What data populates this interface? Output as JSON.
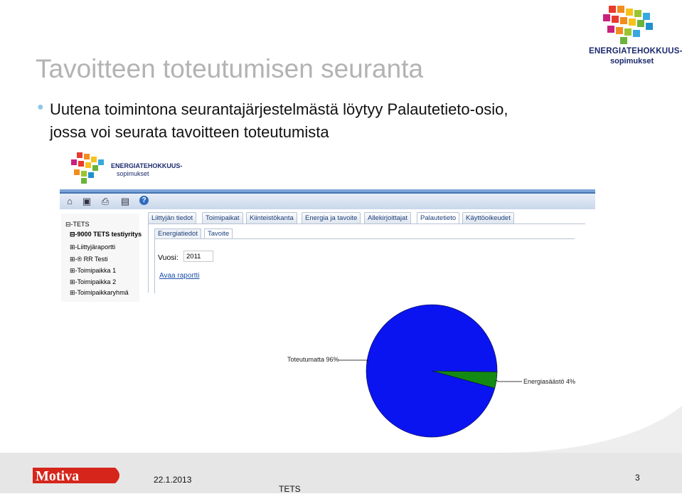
{
  "slide": {
    "title": "Tavoitteen toteutumisen seuranta",
    "body_line1": "Uutena toimintona seurantajärjestelmästä löytyy Palautetieto-osio,",
    "body_line2": "jossa voi seurata tavoitteen toteutumista"
  },
  "brand_logo": {
    "line1": "ENERGIATEHOKKUUS-",
    "line2": "sopimukset"
  },
  "app": {
    "logo_line1": "ENERGIATEHOKKUUS-",
    "logo_line2": "sopimukset",
    "toolbar_icons": [
      "home-icon",
      "save-icon",
      "print-icon",
      "export-icon",
      "help-icon"
    ],
    "tree": {
      "root": "TETS",
      "company": "9000 TETS testiyritys",
      "items": [
        "Liittyjäraportti",
        "® RR Testi",
        "Toimipaikka 1",
        "Toimipaikka 2",
        "Toimipaikkaryhmä"
      ]
    },
    "tabs": [
      "Liittyjän tiedot",
      "Toimipaikat",
      "Kiinteistökanta",
      "Energia ja tavoite",
      "Allekirjoittajat",
      "Palautetieto",
      "Käyttöoikeudet"
    ],
    "active_tab": "Palautetieto",
    "subtabs": [
      "Energiatiedot",
      "Tavoite"
    ],
    "active_subtab": "Tavoite",
    "vuosi_label": "Vuosi:",
    "vuosi_value": "2011",
    "report_link": "Avaa raportti"
  },
  "chart_data": {
    "type": "pie",
    "slices": [
      {
        "label": "Toteutumatta 96%",
        "value": 96,
        "color": "#0a14f0"
      },
      {
        "label": "Energiasäästö 4%",
        "value": 4,
        "color": "#138a13"
      }
    ]
  },
  "footer": {
    "date": "22.1.2013",
    "center": "TETS",
    "page": "3",
    "logo_text": "Motiva"
  }
}
